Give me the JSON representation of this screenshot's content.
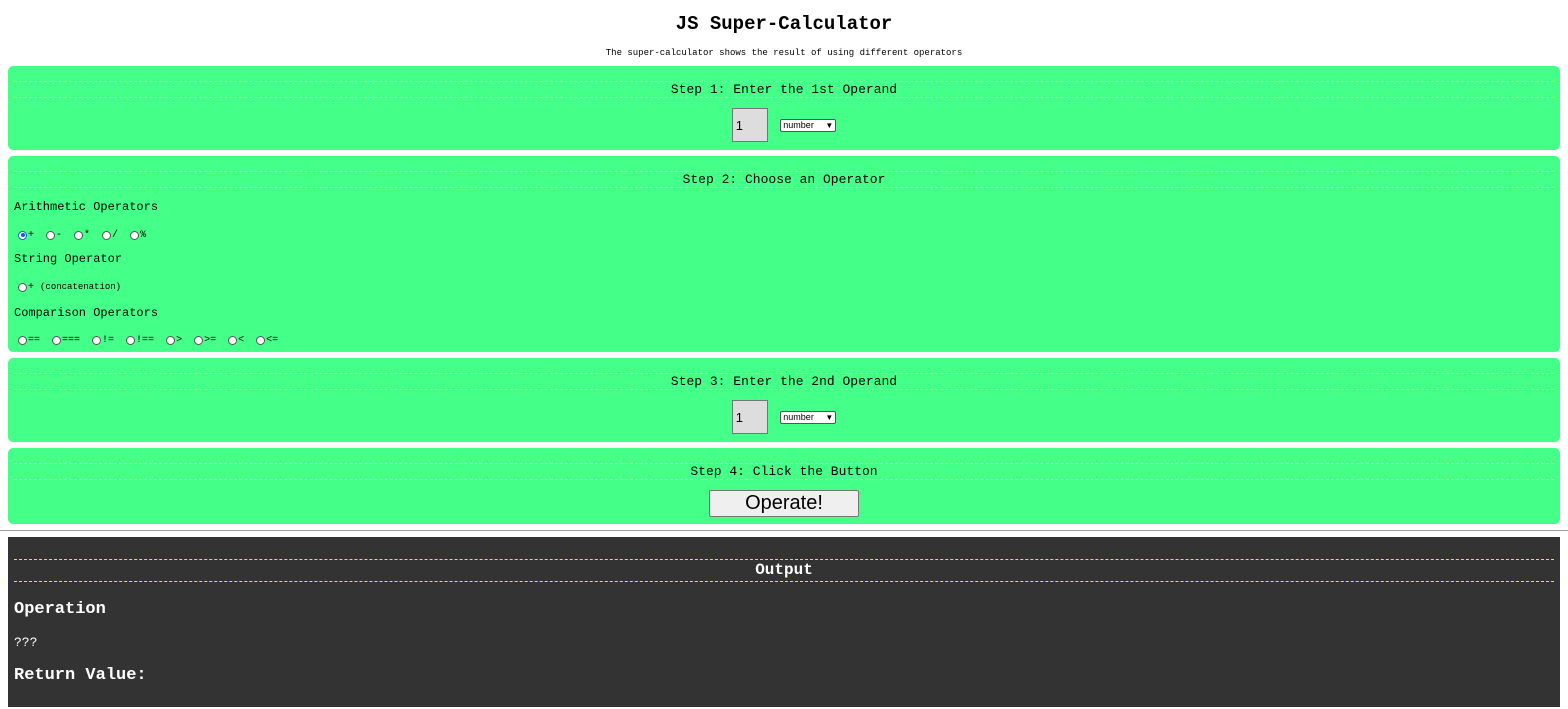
{
  "page": {
    "title": "JS Super-Calculator",
    "subtitle": "The super-calculator shows the result of using different operators"
  },
  "step1": {
    "heading": "Step 1: Enter the 1st Operand",
    "value": "1",
    "type_selected": "number"
  },
  "step2": {
    "heading": "Step 2: Choose an Operator",
    "groups": [
      {
        "label": "Arithmetic Operators",
        "options": [
          "+",
          "-",
          "*",
          "/",
          "%"
        ],
        "checked": "+"
      },
      {
        "label": "String Operator",
        "options": [
          "+"
        ],
        "option_note": "(concatenation)"
      },
      {
        "label": "Comparison Operators",
        "options": [
          "==",
          "===",
          "!=",
          "!==",
          ">",
          ">=",
          "<",
          "<="
        ]
      }
    ]
  },
  "step3": {
    "heading": "Step 3: Enter the 2nd Operand",
    "value": "1",
    "type_selected": "number"
  },
  "step4": {
    "heading": "Step 4: Click the Button",
    "button_label": "Operate!"
  },
  "output": {
    "heading": "Output",
    "operation_label": "Operation",
    "operation_value": "???",
    "return_label": "Return Value:"
  },
  "colors": {
    "panel": "#44ff88",
    "output_bg": "#333333",
    "dashed_rule": "#e6e62a"
  }
}
